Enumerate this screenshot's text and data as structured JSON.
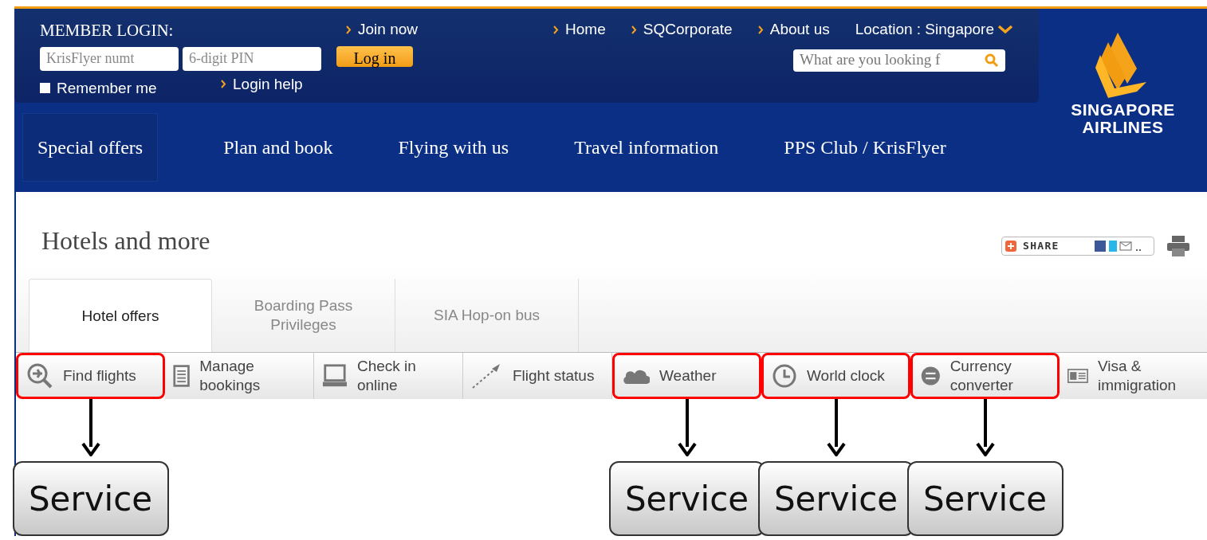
{
  "login": {
    "title": "MEMBER LOGIN:",
    "member_placeholder": "KrisFlyer numt",
    "pin_placeholder": "6-digit PIN",
    "button": "Log in",
    "remember": {
      "label": "Remember me",
      "checked": false
    },
    "links": [
      "Join now",
      "Login help"
    ]
  },
  "top_links": [
    "Home",
    "SQCorporate",
    "About us"
  ],
  "location": "Location : Singapore",
  "search": {
    "placeholder": "What are you looking f"
  },
  "logo": {
    "line1": "SINGAPORE",
    "line2": "AIRLINES"
  },
  "nav": [
    {
      "label": "Special offers",
      "selected": true
    },
    {
      "label": "Plan and book",
      "selected": false
    },
    {
      "label": "Flying with us",
      "selected": false
    },
    {
      "label": "Travel information",
      "selected": false
    },
    {
      "label": "PPS Club / KrisFlyer",
      "selected": false
    }
  ],
  "page_title": "Hotels and more",
  "share": "SHARE",
  "tabs": [
    {
      "label": "Hotel offers",
      "selected": true
    },
    {
      "label": "Boarding Pass Privileges",
      "selected": false
    },
    {
      "label": "SIA Hop-on bus",
      "selected": false
    }
  ],
  "services": [
    {
      "label": "Find flights",
      "kind": "find",
      "highlighted": true,
      "callout": "Service"
    },
    {
      "label": "Manage bookings",
      "kind": "manage",
      "highlighted": false
    },
    {
      "label": "Check in online",
      "kind": "checkin",
      "highlighted": false
    },
    {
      "label": "Flight status",
      "kind": "status",
      "highlighted": false
    },
    {
      "label": "Weather",
      "kind": "weather",
      "highlighted": true,
      "callout": "Service"
    },
    {
      "label": "World clock",
      "kind": "clock",
      "highlighted": true,
      "callout": "Service"
    },
    {
      "label": "Currency converter",
      "kind": "currency",
      "highlighted": true,
      "callout": "Service"
    },
    {
      "label": "Visa & immigration",
      "kind": "visa",
      "highlighted": false
    }
  ]
}
